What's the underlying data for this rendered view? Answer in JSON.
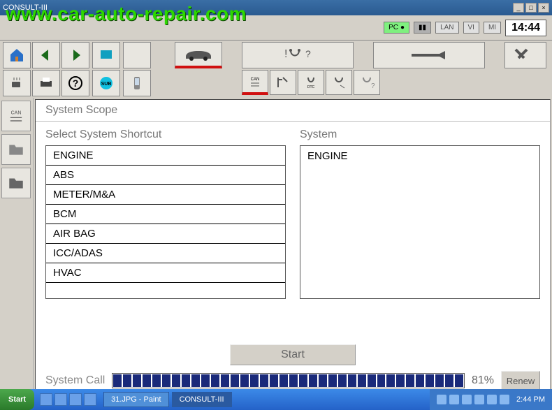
{
  "watermark": "www.car-auto-repair.com",
  "window": {
    "title": "CONSULT-III"
  },
  "status": {
    "pc": "PC",
    "lan": "LAN",
    "vi": "VI",
    "mi": "MI",
    "clock": "14:44"
  },
  "section": {
    "title": "System Scope",
    "shortcut_label": "Select System Shortcut",
    "system_label": "System",
    "items": [
      "ENGINE",
      "ABS",
      "METER/M&A",
      "BCM",
      "AIR BAG",
      "ICC/ADAS",
      "HVAC"
    ],
    "selected_system": "ENGINE",
    "start": "Start"
  },
  "progress": {
    "label": "System Call",
    "percent": "81%",
    "segments": 36,
    "renew": "Renew"
  },
  "taskbar": {
    "start": "Start",
    "tasks": [
      "31.JPG - Paint",
      "CONSULT-III"
    ],
    "tray_clock": "2:44 PM"
  }
}
